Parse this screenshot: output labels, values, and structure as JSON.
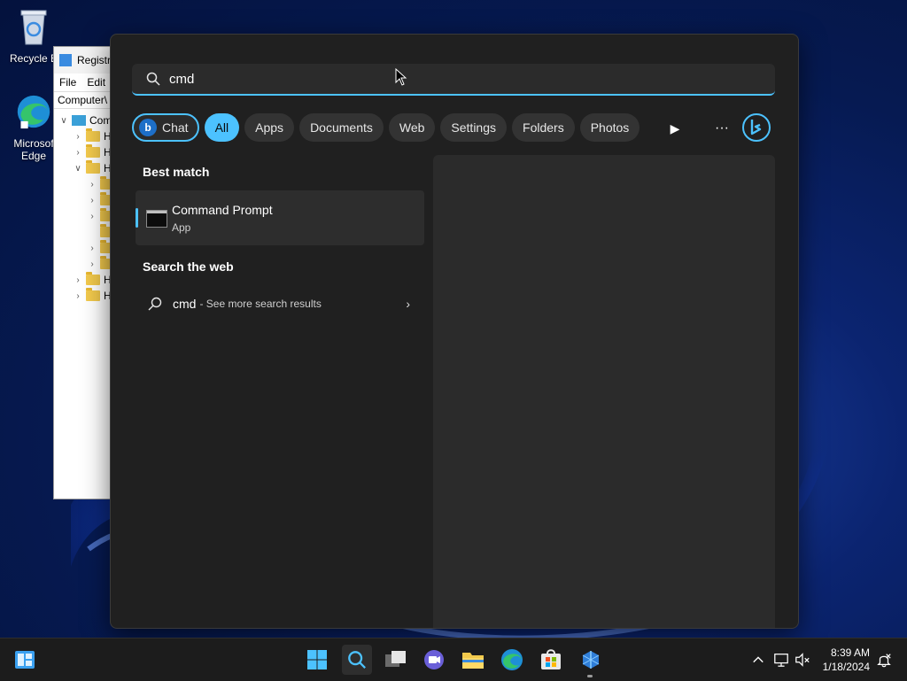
{
  "desktop": {
    "icons": [
      {
        "label": "Recycle B"
      },
      {
        "label": "Microsof Edge"
      }
    ]
  },
  "regedit": {
    "title": "Registr",
    "menu": [
      "File",
      "Edit"
    ],
    "address": "Computer\\",
    "tree_root": "Com",
    "tree_items": [
      "H",
      "H",
      "H",
      "H",
      "H"
    ]
  },
  "search": {
    "query": "cmd",
    "pills": [
      {
        "label": "Chat"
      },
      {
        "label": "All"
      },
      {
        "label": "Apps"
      },
      {
        "label": "Documents"
      },
      {
        "label": "Web"
      },
      {
        "label": "Settings"
      },
      {
        "label": "Folders"
      },
      {
        "label": "Photos"
      }
    ],
    "best_match_title": "Best match",
    "best_match": {
      "name": "Command Prompt",
      "type": "App"
    },
    "web_title": "Search the web",
    "web_query": "cmd",
    "web_more": "- See more search results"
  },
  "taskbar": {
    "time": "8:39 AM",
    "date": "1/18/2024"
  },
  "colors": {
    "accent": "#4cc2ff",
    "flyout_bg": "#202020",
    "preview_bg": "#2b2b2b",
    "taskbar_bg": "#1c1c1c"
  }
}
